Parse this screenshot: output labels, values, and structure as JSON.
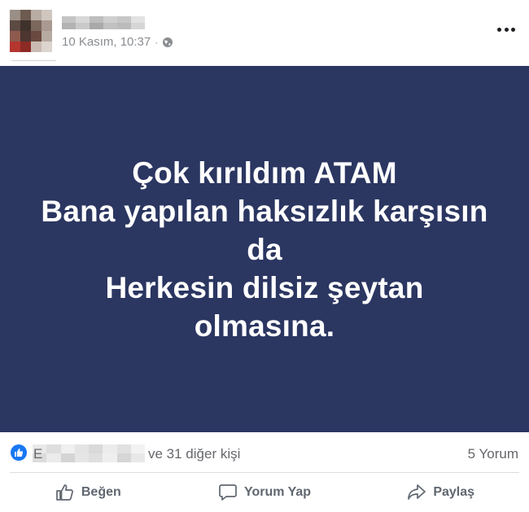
{
  "post": {
    "timestamp": "10 Kasım, 10:37",
    "separator": "·",
    "privacy_icon": "globe-icon",
    "more_icon": "more-dots-icon",
    "text_lines": [
      "Çok kırıldım ATAM",
      "Bana yapılan haksızlık karşısın",
      "da",
      "Herkesin dilsiz şeytan",
      "olmasına."
    ],
    "background_color": "#2b3661"
  },
  "reactions": {
    "icon": "like-icon",
    "first_letter": "E",
    "others_text": "ve 31 diğer kişi",
    "comments_text": "5 Yorum"
  },
  "actions": {
    "like_label": "Beğen",
    "comment_label": "Yorum Yap",
    "share_label": "Paylaş"
  },
  "colors": {
    "accent": "#1877f2",
    "muted_text": "#65676b"
  }
}
